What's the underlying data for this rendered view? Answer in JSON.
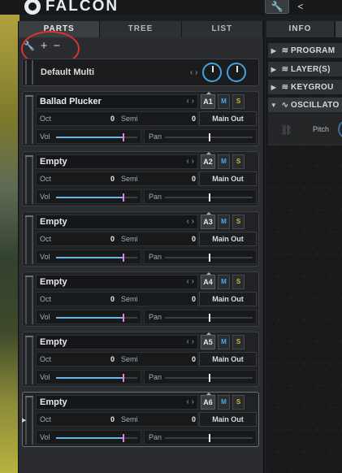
{
  "app": {
    "title": "FALCON"
  },
  "top_tools": {
    "wrench": "🔧",
    "back_arrow": "<"
  },
  "tabs": [
    {
      "label": "PARTS",
      "active": true
    },
    {
      "label": "TREE",
      "active": false
    },
    {
      "label": "LIST",
      "active": false
    }
  ],
  "tools": {
    "wrench": "🔧",
    "add": "+",
    "remove": "−"
  },
  "multi": {
    "name": "Default Multi",
    "nav": "‹ ›"
  },
  "parts": [
    {
      "name": "Ballad Plucker",
      "slot": "A1",
      "oct_label": "Oct",
      "oct": "0",
      "semi_label": "Semi",
      "semi": "0",
      "output": "Main Out",
      "vol_label": "Vol",
      "pan_label": "Pan",
      "vol": 0.82,
      "pan": 0.5
    },
    {
      "name": "Empty",
      "slot": "A2",
      "oct_label": "Oct",
      "oct": "0",
      "semi_label": "Semi",
      "semi": "0",
      "output": "Main Out",
      "vol_label": "Vol",
      "pan_label": "Pan",
      "vol": 0.82,
      "pan": 0.5
    },
    {
      "name": "Empty",
      "slot": "A3",
      "oct_label": "Oct",
      "oct": "0",
      "semi_label": "Semi",
      "semi": "0",
      "output": "Main Out",
      "vol_label": "Vol",
      "pan_label": "Pan",
      "vol": 0.82,
      "pan": 0.5
    },
    {
      "name": "Empty",
      "slot": "A4",
      "oct_label": "Oct",
      "oct": "0",
      "semi_label": "Semi",
      "semi": "0",
      "output": "Main Out",
      "vol_label": "Vol",
      "pan_label": "Pan",
      "vol": 0.82,
      "pan": 0.5
    },
    {
      "name": "Empty",
      "slot": "A5",
      "oct_label": "Oct",
      "oct": "0",
      "semi_label": "Semi",
      "semi": "0",
      "output": "Main Out",
      "vol_label": "Vol",
      "pan_label": "Pan",
      "vol": 0.82,
      "pan": 0.5
    },
    {
      "name": "Empty",
      "slot": "A6",
      "oct_label": "Oct",
      "oct": "0",
      "semi_label": "Semi",
      "semi": "0",
      "output": "Main Out",
      "vol_label": "Vol",
      "pan_label": "Pan",
      "vol": 0.82,
      "pan": 0.5
    }
  ],
  "part_buttons": {
    "mute": "M",
    "solo": "S"
  },
  "right_panel": {
    "tab": "INFO",
    "tree": [
      {
        "label": "PROGRAM",
        "icon": "layers-icon"
      },
      {
        "label": "LAYER(S)",
        "icon": "layers-icon"
      },
      {
        "label": "KEYGROU",
        "icon": "layers-icon"
      },
      {
        "label": "OSCILLATO",
        "icon": "waveform-icon"
      }
    ],
    "pitch_label": "Pitch"
  },
  "colors": {
    "accent_blue": "#3ea3e0",
    "mute_blue": "#4fa8e8",
    "solo_yellow": "#d7b43a",
    "annotation_red": "#e0312c",
    "vol_pink": "#e77fe0"
  }
}
